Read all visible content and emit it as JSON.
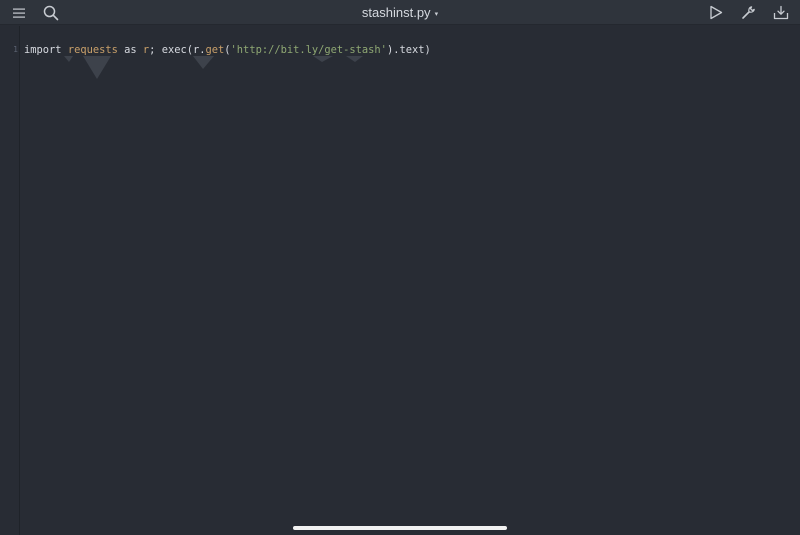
{
  "toolbar": {
    "menu_icon": "hamburger-menu-icon",
    "search_icon": "search-icon",
    "file_name": "stashinst.py",
    "title_dropdown_glyph": "▾",
    "run_icon": "play-icon",
    "tools_icon": "wrench-icon",
    "share_icon": "download-tray-icon"
  },
  "editor": {
    "line_number": "1",
    "code": {
      "import_kw": "import",
      "module": "requests",
      "as_kw": "as",
      "alias": "r",
      "semicolon": ";",
      "exec_call": "exec(",
      "r_obj": "r.",
      "get_method": "get",
      "open_paren": "(",
      "url_string": "'http://bit.ly/get-stash'",
      "close_text": ").text)"
    }
  },
  "colors": {
    "background": "#282c34",
    "toolbar": "#2f343c",
    "string": "#8fa873",
    "identifier_warning": "#c9a06a"
  }
}
